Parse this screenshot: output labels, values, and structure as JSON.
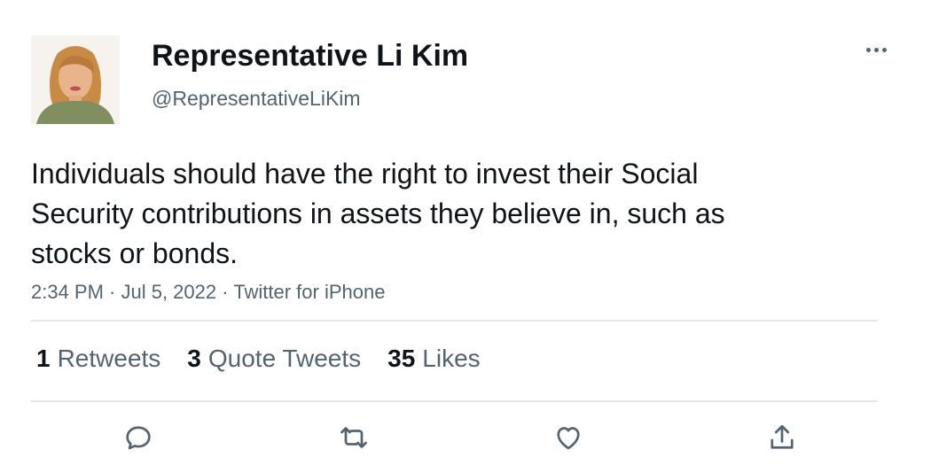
{
  "author": {
    "display_name": "Representative Li Kim",
    "handle": "@RepresentativeLiKim"
  },
  "tweet": {
    "text": "Individuals should have the right to invest their Social Security contributions in assets they believe in, such as stocks or bonds.",
    "meta": "2:34 PM · Jul 5, 2022 · Twitter for iPhone"
  },
  "stats": [
    {
      "count": "1",
      "label": "Retweets"
    },
    {
      "count": "3",
      "label": "Quote Tweets"
    },
    {
      "count": "35",
      "label": "Likes"
    }
  ],
  "actions": [
    {
      "icon": "reply-icon"
    },
    {
      "icon": "retweet-icon"
    },
    {
      "icon": "like-icon"
    },
    {
      "icon": "share-icon"
    }
  ],
  "colors": {
    "text": "#0f1419",
    "secondary": "#536471",
    "divider": "#e3e6e8"
  }
}
